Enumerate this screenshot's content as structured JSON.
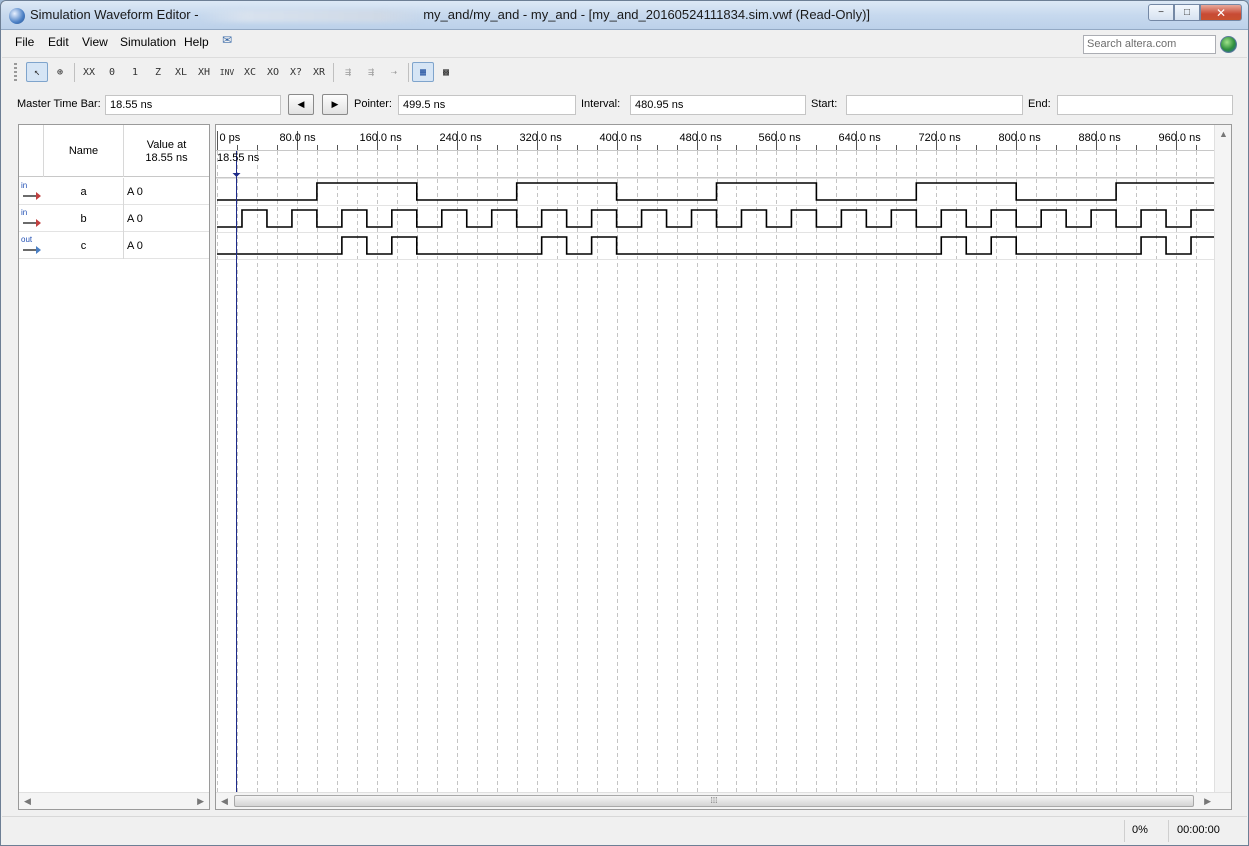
{
  "window": {
    "title_prefix": "Simulation Waveform Editor -",
    "title_suffix": "my_and/my_and - my_and - [my_and_20160524111834.sim.vwf (Read-Only)]",
    "minimize": "−",
    "maximize": "□",
    "close": "✕"
  },
  "menu": [
    "File",
    "Edit",
    "View",
    "Simulation",
    "Help"
  ],
  "search": {
    "placeholder": "Search altera.com"
  },
  "toolbar": {
    "icons": [
      "pointer-tool-icon",
      "zoom-tool-icon",
      "force-unknown-icon",
      "force-low-icon",
      "force-high-icon",
      "force-hiz-icon",
      "force-weak-low-icon",
      "force-weak-high-icon",
      "invert-icon",
      "count-value-icon",
      "clock-icon",
      "random-value-icon",
      "overwrite-value-icon",
      "functional-sim-icon",
      "timing-sim-icon",
      "netlist-viewer-icon",
      "snap-to-grid-icon",
      "grid-icon"
    ],
    "glyphs": [
      "↖",
      "⊕",
      "XX",
      "0",
      "1",
      "Z",
      "XL",
      "XH",
      "INV",
      "XC",
      "XO",
      "X?",
      "XR",
      "⇶",
      "⇶",
      "⇢",
      "▦",
      "▩"
    ]
  },
  "controls": {
    "master_time_bar_label": "Master Time Bar:",
    "master_time_bar_value": "18.55 ns",
    "pointer_label": "Pointer:",
    "pointer_value": "499.5 ns",
    "interval_label": "Interval:",
    "interval_value": "480.95 ns",
    "start_label": "Start:",
    "start_value": "",
    "end_label": "End:",
    "end_value": ""
  },
  "signal_table": {
    "name_header": "Name",
    "value_header_line1": "Value at",
    "value_header_line2": "18.55 ns",
    "signals": [
      {
        "dir": "in",
        "name": "a",
        "value": "A 0"
      },
      {
        "dir": "in",
        "name": "b",
        "value": "A 0"
      },
      {
        "dir": "out",
        "name": "c",
        "value": "A 0"
      }
    ]
  },
  "timeline": {
    "tick_labels": [
      "0 ps",
      "80.0 ns",
      "160.0 ns",
      "240.0 ns",
      "320.0 ns",
      "400.0 ns",
      "480.0 ns",
      "560.0 ns",
      "640.0 ns",
      "720.0 ns",
      "800.0 ns",
      "880.0 ns",
      "960.0 ns"
    ],
    "tick_values_ns": [
      0,
      80,
      160,
      240,
      320,
      400,
      480,
      560,
      640,
      720,
      800,
      880,
      960
    ],
    "grid_step_ns": 20,
    "time_end_ns": 1000,
    "master_time_ns": 18.55,
    "master_time_label": "18.55 ns"
  },
  "waveforms": {
    "a": {
      "initial": 0,
      "transitions_ns": [
        100,
        200,
        300,
        400,
        500,
        600,
        700,
        800,
        900
      ]
    },
    "b": {
      "initial": 0,
      "period_ns": 50,
      "high_first_ns": 25
    },
    "c": {
      "initial": 0,
      "high_intervals_ns": [
        [
          125,
          150
        ],
        [
          175,
          200
        ],
        [
          325,
          350
        ],
        [
          375,
          400
        ],
        [
          725,
          750
        ],
        [
          775,
          800
        ],
        [
          925,
          950
        ],
        [
          975,
          1000
        ]
      ]
    }
  },
  "status": {
    "progress": "0%",
    "elapsed": "00:00:00"
  }
}
